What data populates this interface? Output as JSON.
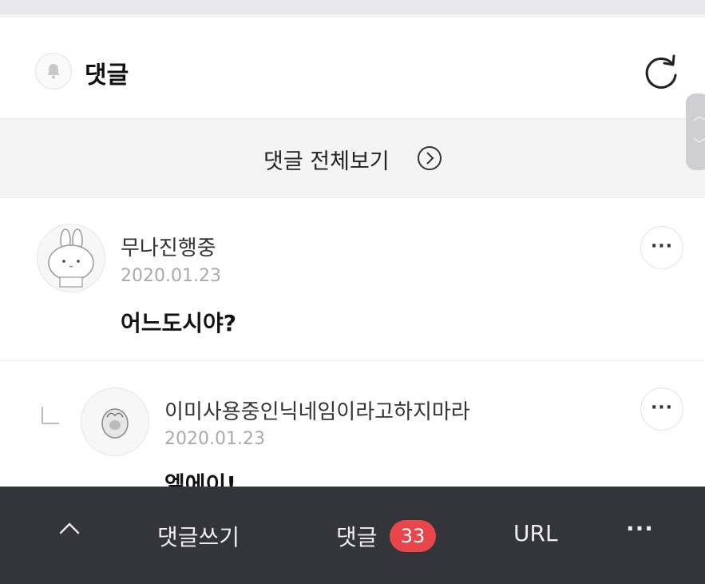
{
  "header": {
    "title": "댓글",
    "bell_icon": "bell-icon",
    "refresh_icon": "refresh-icon"
  },
  "see_all": {
    "label": "댓글 전체보기",
    "icon": "chevron-right-circle-icon"
  },
  "comments": [
    {
      "nickname": "무나진행중",
      "date": "2020.01.23",
      "text": "어느도시야?",
      "avatar": "bunny-avatar",
      "more_label": "···"
    },
    {
      "nickname": "이미사용중인닉네임이라고하지마라",
      "date": "2020.01.23",
      "text": "엘에이!",
      "avatar": "character-avatar",
      "more_label": "···",
      "is_reply": true
    }
  ],
  "bottom_bar": {
    "up_label": "^",
    "write_label": "댓글쓰기",
    "comments_label": "댓글",
    "comments_count": "33",
    "url_label": "URL",
    "more_label": "···"
  },
  "colors": {
    "bottom_bar_bg": "#34353b",
    "badge_bg": "#e8464b",
    "see_all_bg": "#f4f4f5"
  }
}
